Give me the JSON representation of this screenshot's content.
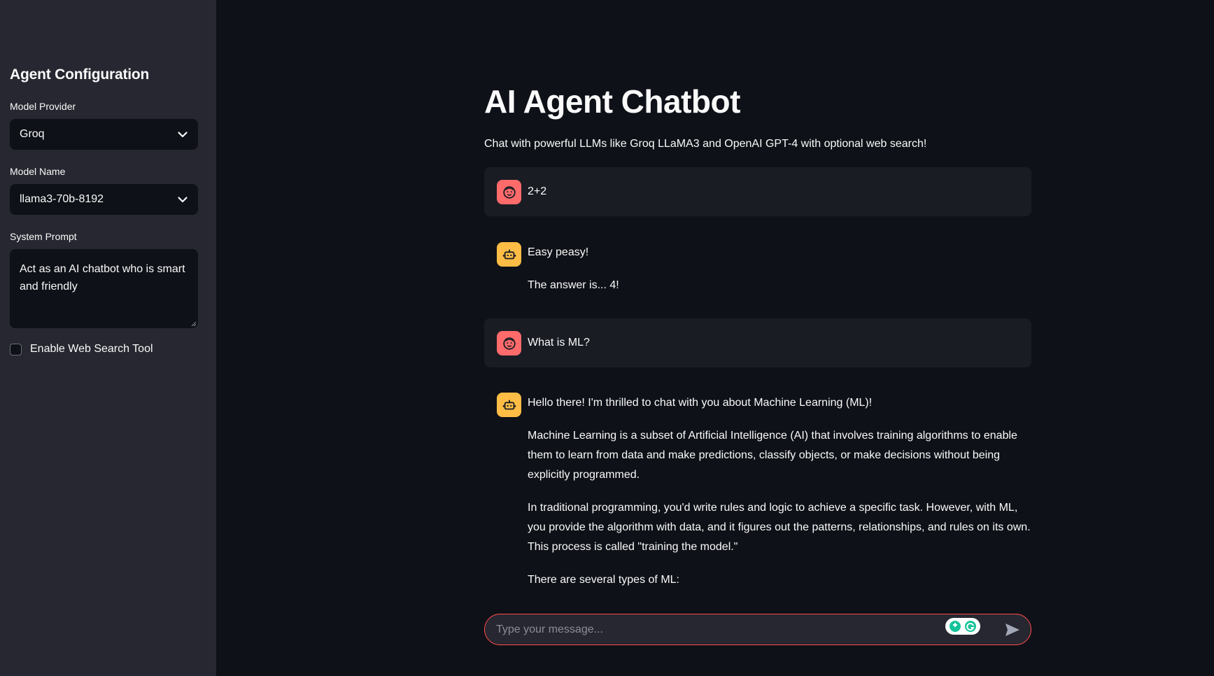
{
  "sidebar": {
    "title": "Agent Configuration",
    "provider_label": "Model Provider",
    "provider_value": "Groq",
    "model_label": "Model Name",
    "model_value": "llama3-70b-8192",
    "prompt_label": "System Prompt",
    "prompt_value": "Act as an AI chatbot who is smart and friendly",
    "websearch_label": "Enable Web Search Tool",
    "websearch_checked": false
  },
  "main": {
    "title": "AI Agent Chatbot",
    "subtitle": "Chat with powerful LLMs like Groq LLaMA3 and OpenAI GPT-4 with optional web search!",
    "messages": [
      {
        "role": "user",
        "text": "2+2"
      },
      {
        "role": "assistant",
        "p1": "Easy peasy!",
        "p2": "The answer is... 4!"
      },
      {
        "role": "user",
        "text": "What is ML?"
      },
      {
        "role": "assistant",
        "p1": "Hello there! I'm thrilled to chat with you about Machine Learning (ML)!",
        "p2": "Machine Learning is a subset of Artificial Intelligence (AI) that involves training algorithms to enable them to learn from data and make predictions, classify objects, or make decisions without being explicitly programmed.",
        "p3": "In traditional programming, you'd write rules and logic to achieve a specific task. However, with ML, you provide the algorithm with data, and it figures out the patterns, relationships, and rules on its own. This process is called \"training the model.\"",
        "p4": "There are several types of ML:"
      }
    ],
    "input_placeholder": "Type your message..."
  },
  "colors": {
    "background": "#0e1117",
    "sidebar": "#262730",
    "user_avatar": "#ff6b6b",
    "bot_avatar": "#ffbd45",
    "input_border": "#ff4b4b"
  },
  "icons": {
    "select_chevron": "chevron-down-icon",
    "user_avatar": "face-icon",
    "bot_avatar": "robot-icon",
    "send": "send-icon",
    "grammarly": "grammarly-icon"
  }
}
